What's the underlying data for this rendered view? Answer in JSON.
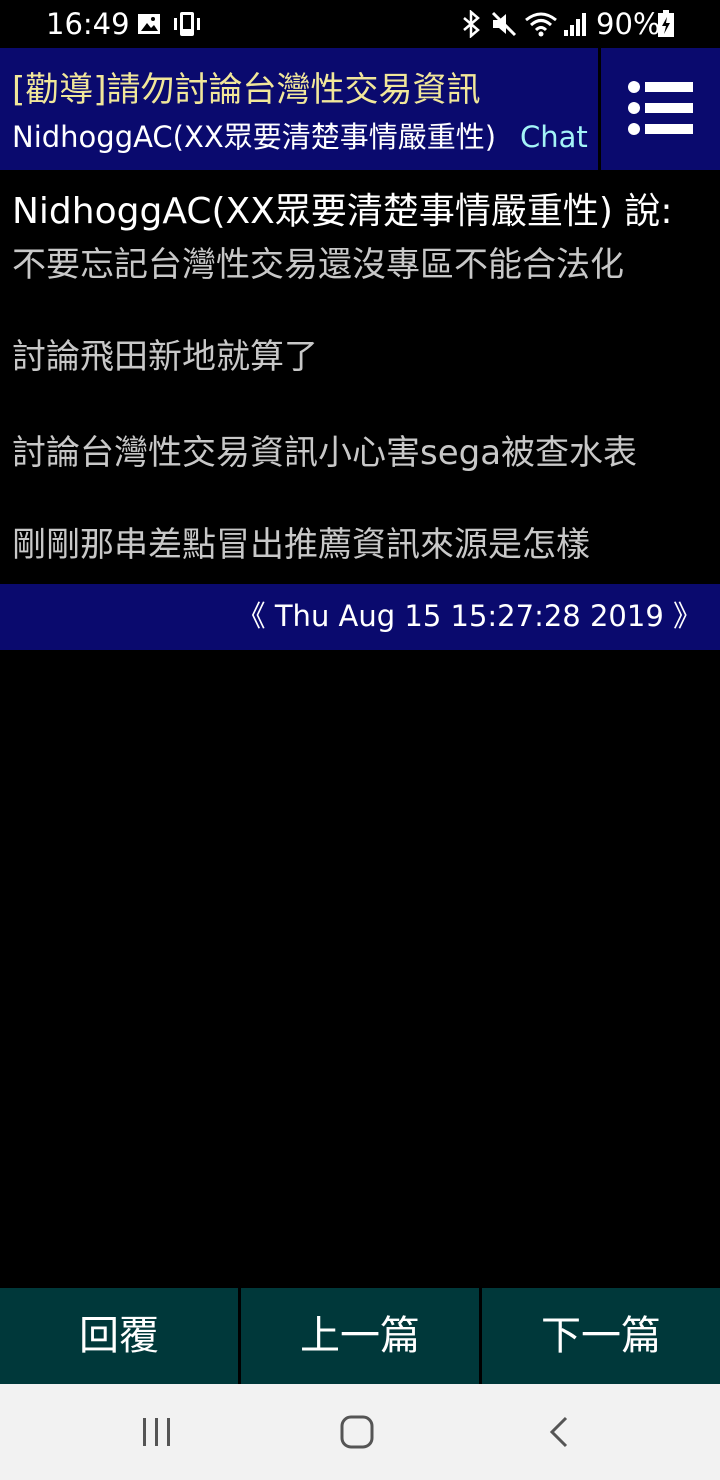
{
  "status_bar": {
    "time": "16:49",
    "battery": "90%",
    "icons": [
      "image-icon",
      "phone-vibrate-icon",
      "bluetooth-icon",
      "mute-icon",
      "wifi-icon",
      "signal-icon",
      "battery-charging-icon"
    ]
  },
  "header": {
    "title": "[勸導]請勿討論台灣性交易資訊",
    "author": "NidhoggAC(XX眾要清楚事情嚴重性)",
    "board": "Chat",
    "menu_icon": "list-menu-icon"
  },
  "post": {
    "author_line": "NidhoggAC(XX眾要清楚事情嚴重性) 說:",
    "lines": [
      "不要忘記台灣性交易還沒專區不能合法化",
      "討論飛田新地就算了",
      "討論台灣性交易資訊小心害sega被查水表",
      "剛剛那串差點冒出推薦資訊來源是怎樣"
    ],
    "date": "《 Thu Aug 15 15:27:28 2019 》"
  },
  "actions": {
    "reply": "回覆",
    "prev": "上一篇",
    "next": "下一篇"
  },
  "nav": {
    "icons": [
      "recent-apps-icon",
      "home-icon",
      "back-icon"
    ]
  },
  "colors": {
    "header_bg": "#0a0a6e",
    "title": "#f1e79a",
    "board": "#a4f4f7",
    "action_bg": "#00383a",
    "body_text": "#c8c8c8"
  }
}
